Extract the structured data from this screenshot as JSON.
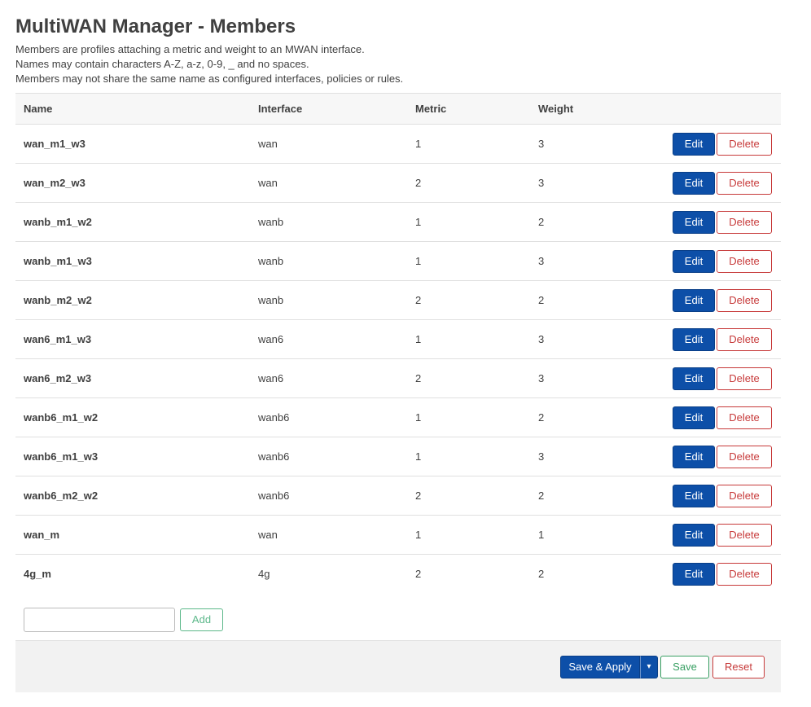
{
  "page": {
    "title": "MultiWAN Manager - Members",
    "description": [
      "Members are profiles attaching a metric and weight to an MWAN interface.",
      "Names may contain characters A-Z, a-z, 0-9, _ and no spaces.",
      "Members may not share the same name as configured interfaces, policies or rules."
    ]
  },
  "table": {
    "headers": {
      "name": "Name",
      "interface": "Interface",
      "metric": "Metric",
      "weight": "Weight"
    },
    "edit_label": "Edit",
    "delete_label": "Delete",
    "rows": [
      {
        "name": "wan_m1_w3",
        "interface": "wan",
        "metric": "1",
        "weight": "3"
      },
      {
        "name": "wan_m2_w3",
        "interface": "wan",
        "metric": "2",
        "weight": "3"
      },
      {
        "name": "wanb_m1_w2",
        "interface": "wanb",
        "metric": "1",
        "weight": "2"
      },
      {
        "name": "wanb_m1_w3",
        "interface": "wanb",
        "metric": "1",
        "weight": "3"
      },
      {
        "name": "wanb_m2_w2",
        "interface": "wanb",
        "metric": "2",
        "weight": "2"
      },
      {
        "name": "wan6_m1_w3",
        "interface": "wan6",
        "metric": "1",
        "weight": "3"
      },
      {
        "name": "wan6_m2_w3",
        "interface": "wan6",
        "metric": "2",
        "weight": "3"
      },
      {
        "name": "wanb6_m1_w2",
        "interface": "wanb6",
        "metric": "1",
        "weight": "2"
      },
      {
        "name": "wanb6_m1_w3",
        "interface": "wanb6",
        "metric": "1",
        "weight": "3"
      },
      {
        "name": "wanb6_m2_w2",
        "interface": "wanb6",
        "metric": "2",
        "weight": "2"
      },
      {
        "name": "wan_m",
        "interface": "wan",
        "metric": "1",
        "weight": "1"
      },
      {
        "name": "4g_m",
        "interface": "4g",
        "metric": "2",
        "weight": "2"
      }
    ]
  },
  "add": {
    "input_value": "",
    "button_label": "Add"
  },
  "footer": {
    "save_apply_label": "Save & Apply",
    "dropdown_glyph": "▾",
    "save_label": "Save",
    "reset_label": "Reset"
  },
  "colors": {
    "primary": "#0d4fa8",
    "danger": "#c73a3a",
    "success": "#3aa064",
    "add_accent": "#5cb88a"
  }
}
